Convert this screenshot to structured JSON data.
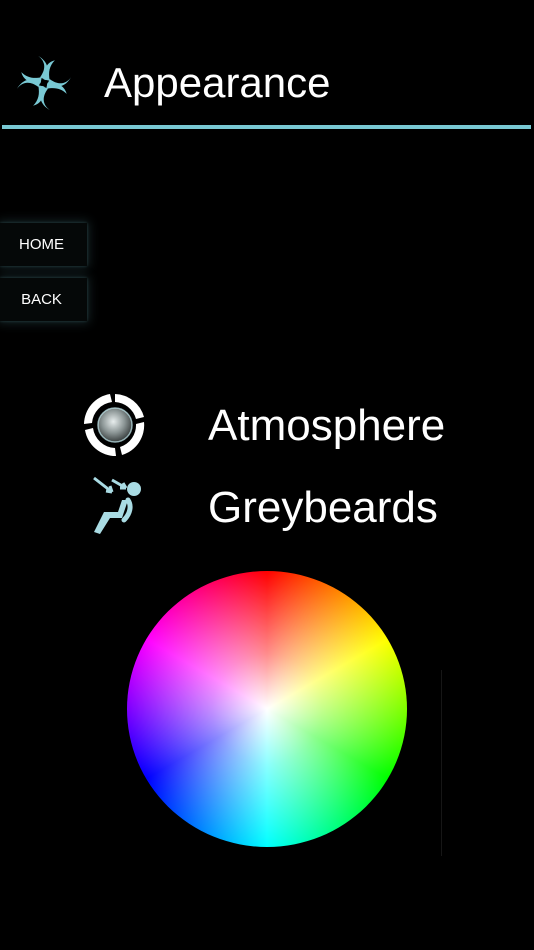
{
  "header": {
    "title": "Appearance",
    "logo_icon": "pinwheel-logo-icon",
    "accent_color": "#79c9d4"
  },
  "nav": {
    "home_label": "HOME",
    "back_label": "BACK"
  },
  "settings": [
    {
      "label": "Atmosphere",
      "icon": "atmosphere-ring-icon"
    },
    {
      "label": "Greybeards",
      "icon": "reclining-seat-icon"
    }
  ],
  "color_picker": {
    "type": "hue-saturation-wheel"
  }
}
